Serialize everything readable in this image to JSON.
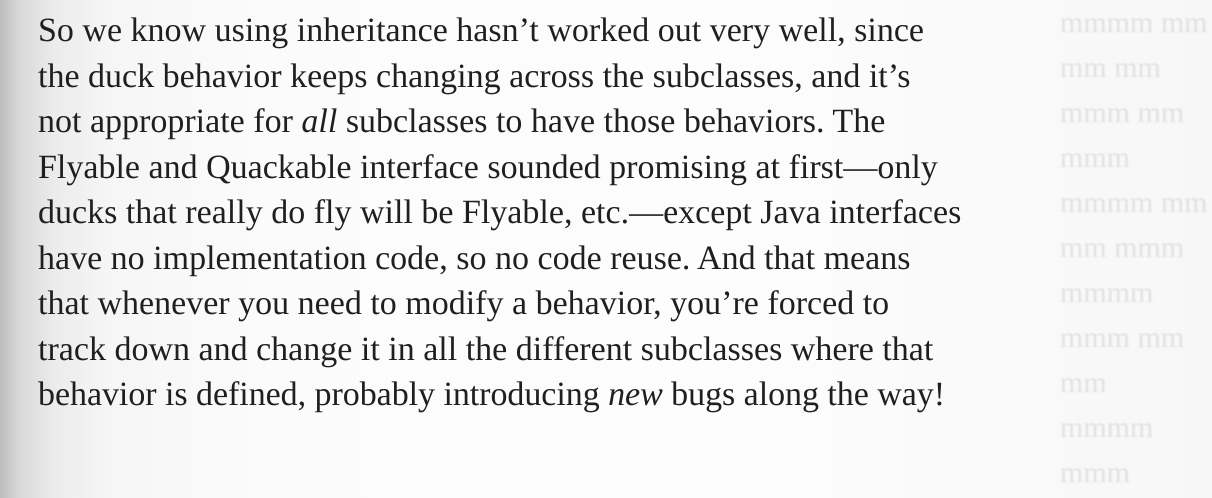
{
  "paragraph": {
    "lines": [
      {
        "before": "So we know using inheritance hasn’t worked out very well, since"
      },
      {
        "before": "the duck behavior keeps changing across the subclasses, and it’s"
      },
      {
        "before": "not appropriate for ",
        "emphasis": "all",
        "after": " subclasses to have those behaviors. The"
      },
      {
        "before": "Flyable and Quackable interface sounded promising at first—only"
      },
      {
        "before": "ducks that really do fly will be Flyable, etc.—except Java interfaces"
      },
      {
        "before": "have no implementation code, so no code reuse. And that means"
      },
      {
        "before": "that whenever you need to modify a behavior, you’re forced to"
      },
      {
        "before": "track down and change it in all the different subclasses where that"
      },
      {
        "before": "behavior is defined, probably introducing ",
        "emphasis": "new",
        "after": " bugs along the way!"
      }
    ]
  }
}
